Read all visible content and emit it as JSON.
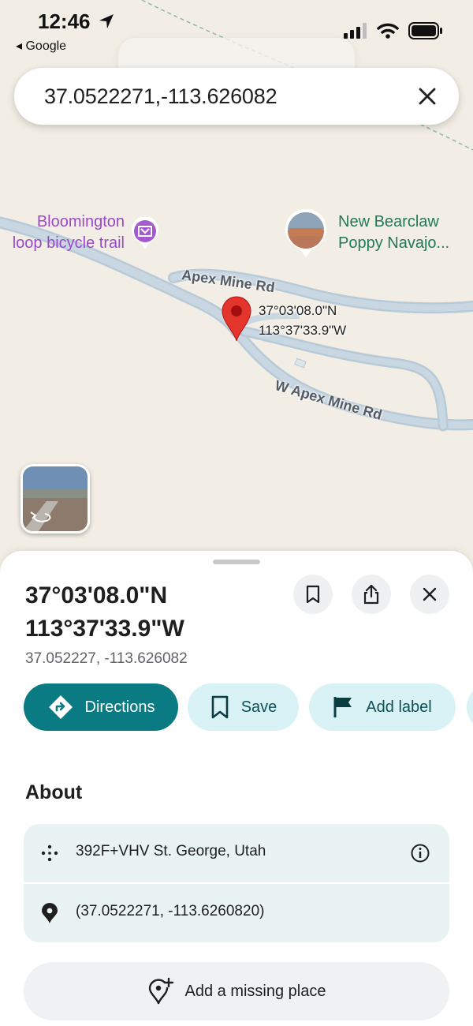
{
  "status_bar": {
    "time": "12:46",
    "back_app": "◂ Google",
    "icons": [
      "location-arrow-icon",
      "cellular-signal-icon",
      "wifi-icon",
      "battery-icon"
    ]
  },
  "search": {
    "value": "37.0522271,-113.626082"
  },
  "map": {
    "pois": [
      {
        "name_line1": "Bloomington",
        "name_line2": "loop bicycle trail",
        "icon": "museum-icon"
      },
      {
        "name_line1": "New Bearclaw",
        "name_line2": "Poppy Navajo...",
        "icon": "photo-thumbnail"
      }
    ],
    "roads": [
      "Apex Mine Rd",
      "W Apex Mine Rd"
    ],
    "pin": {
      "lat_dms": "37°03'08.0\"N",
      "lng_dms": "113°37'33.9\"W"
    }
  },
  "place": {
    "title_line1": "37°03'08.0\"N",
    "title_line2": "113°37'33.9\"W",
    "coords_decimal": "37.052227, -113.626082"
  },
  "actions": {
    "directions": "Directions",
    "save": "Save",
    "add_label": "Add label"
  },
  "about": {
    "heading": "About",
    "plus_code": "392F+VHV St. George, Utah",
    "coordinates": "(37.0522271, -113.6260820)"
  },
  "add_missing_place": "Add a missing place",
  "colors": {
    "accent": "#0b7b83",
    "chip_secondary": "#d9f2f6",
    "map_bg": "#f2eee5",
    "road": "#b8cad8",
    "pin": "#d93025",
    "poi_purple": "#9b48c9",
    "poi_green": "#1f7a5a"
  }
}
